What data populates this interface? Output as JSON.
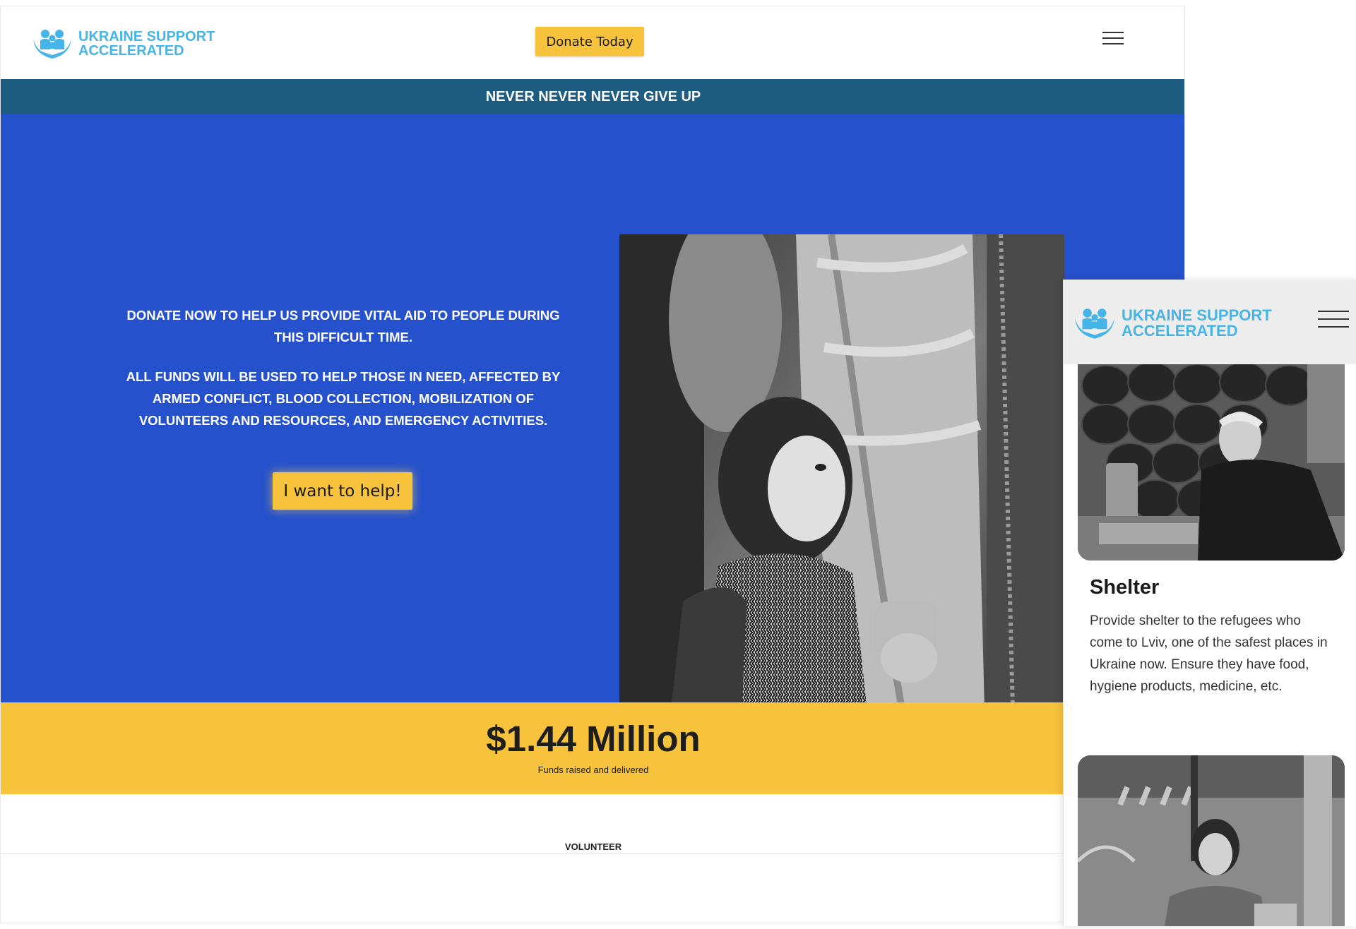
{
  "brand": {
    "name_line1": "UKRAINE SUPPORT",
    "name_line2": "ACCELERATED",
    "color": "#45b4e6"
  },
  "header": {
    "donate_label": "Donate Today"
  },
  "banner": {
    "text": "NEVER NEVER NEVER GIVE UP"
  },
  "hero": {
    "paragraph1": "DONATE NOW TO HELP US PROVIDE VITAL AID TO PEOPLE DURING THIS DIFFICULT TIME.",
    "paragraph2": "ALL FUNDS WILL BE USED TO HELP THOSE IN NEED, AFFECTED BY ARMED CONFLICT, BLOOD COLLECTION, MOBILIZATION OF VOLUNTEERS AND RESOURCES, AND EMERGENCY ACTIVITIES.",
    "cta_label": "I want to help!",
    "photo_icon": "child-holding-hand-photo"
  },
  "stats": {
    "amount": "$1.44 Million",
    "caption": "Funds raised and delivered"
  },
  "next_section": {
    "label": "VOLUNTEER"
  },
  "mobile": {
    "card": {
      "title": "Shelter",
      "description": "Provide shelter to the refugees who come to Lviv, one of the safest places in Ukraine now. Ensure they have food, hygiene products, medicine, etc.",
      "photo_icon": "volunteer-with-sleeping-bags-photo"
    },
    "next_card_photo_icon": "woman-on-street-photo"
  },
  "colors": {
    "banner": "#1f5c82",
    "hero": "#2651cc",
    "yellow": "#f8c33c"
  }
}
